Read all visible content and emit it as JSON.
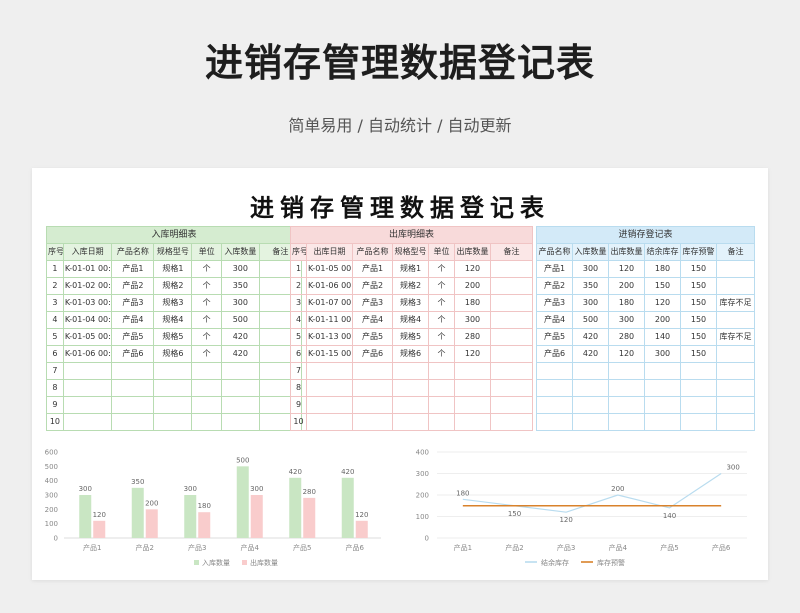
{
  "header": {
    "title": "进销存管理数据登记表",
    "subtitle": "简单易用 / 自动统计 / 自动更新"
  },
  "sheet": {
    "title": "进销存管理数据登记表"
  },
  "in_table": {
    "caption": "入库明细表",
    "headers": [
      "序号",
      "入库日期",
      "产品名称",
      "规格型号",
      "单位",
      "入库数量",
      "备注"
    ],
    "rows": [
      [
        "1",
        "K-01-01 00:0",
        "产品1",
        "规格1",
        "个",
        "300",
        ""
      ],
      [
        "2",
        "K-01-02 00:0",
        "产品2",
        "规格2",
        "个",
        "350",
        ""
      ],
      [
        "3",
        "K-01-03 00:0",
        "产品3",
        "规格3",
        "个",
        "300",
        ""
      ],
      [
        "4",
        "K-01-04 00:0",
        "产品4",
        "规格4",
        "个",
        "500",
        ""
      ],
      [
        "5",
        "K-01-05 00:0",
        "产品5",
        "规格5",
        "个",
        "420",
        ""
      ],
      [
        "6",
        "K-01-06 00:0",
        "产品6",
        "规格6",
        "个",
        "420",
        ""
      ],
      [
        "7",
        "",
        "",
        "",
        "",
        "",
        ""
      ],
      [
        "8",
        "",
        "",
        "",
        "",
        "",
        ""
      ],
      [
        "9",
        "",
        "",
        "",
        "",
        "",
        ""
      ],
      [
        "10",
        "",
        "",
        "",
        "",
        "",
        ""
      ]
    ]
  },
  "out_table": {
    "caption": "出库明细表",
    "headers": [
      "序号",
      "出库日期",
      "产品名称",
      "规格型号",
      "单位",
      "出库数量",
      "备注"
    ],
    "rows": [
      [
        "1",
        "K-01-05 00:0",
        "产品1",
        "规格1",
        "个",
        "120",
        ""
      ],
      [
        "2",
        "K-01-06 00:0",
        "产品2",
        "规格2",
        "个",
        "200",
        ""
      ],
      [
        "3",
        "K-01-07 00:0",
        "产品3",
        "规格3",
        "个",
        "180",
        ""
      ],
      [
        "4",
        "K-01-11 00:0",
        "产品4",
        "规格4",
        "个",
        "300",
        ""
      ],
      [
        "5",
        "K-01-13 00:0",
        "产品5",
        "规格5",
        "个",
        "280",
        ""
      ],
      [
        "6",
        "K-01-15 00:0",
        "产品6",
        "规格6",
        "个",
        "120",
        ""
      ],
      [
        "7",
        "",
        "",
        "",
        "",
        "",
        ""
      ],
      [
        "8",
        "",
        "",
        "",
        "",
        "",
        ""
      ],
      [
        "9",
        "",
        "",
        "",
        "",
        "",
        ""
      ],
      [
        "10",
        "",
        "",
        "",
        "",
        "",
        ""
      ]
    ]
  },
  "stock_table": {
    "caption": "进销存登记表",
    "headers": [
      "产品名称",
      "入库数量",
      "出库数量",
      "结余库存",
      "库存预警",
      "备注"
    ],
    "rows": [
      [
        "产品1",
        "300",
        "120",
        "180",
        "150",
        ""
      ],
      [
        "产品2",
        "350",
        "200",
        "150",
        "150",
        ""
      ],
      [
        "产品3",
        "300",
        "180",
        "120",
        "150",
        "库存不足"
      ],
      [
        "产品4",
        "500",
        "300",
        "200",
        "150",
        ""
      ],
      [
        "产品5",
        "420",
        "280",
        "140",
        "150",
        "库存不足"
      ],
      [
        "产品6",
        "420",
        "120",
        "300",
        "150",
        ""
      ],
      [
        "",
        "",
        "",
        "",
        "",
        ""
      ],
      [
        "",
        "",
        "",
        "",
        "",
        ""
      ],
      [
        "",
        "",
        "",
        "",
        "",
        ""
      ],
      [
        "",
        "",
        "",
        "",
        "",
        ""
      ]
    ]
  },
  "chart_data": [
    {
      "type": "bar",
      "categories": [
        "产品1",
        "产品2",
        "产品3",
        "产品4",
        "产品5",
        "产品6"
      ],
      "series": [
        {
          "name": "入库数量",
          "values": [
            300,
            350,
            300,
            500,
            420,
            420
          ],
          "color": "#c9e6c3"
        },
        {
          "name": "出库数量",
          "values": [
            120,
            200,
            180,
            300,
            280,
            120
          ],
          "color": "#f9cccc"
        }
      ],
      "ylim": [
        0,
        600
      ],
      "yticks": [
        0,
        100,
        200,
        300,
        400,
        500,
        600
      ],
      "legend": "bottom",
      "grid": false
    },
    {
      "type": "line",
      "categories": [
        "产品1",
        "产品2",
        "产品3",
        "产品4",
        "产品5",
        "产品6"
      ],
      "series": [
        {
          "name": "结余库存",
          "values": [
            180,
            150,
            120,
            200,
            140,
            300
          ],
          "color": "#b9dcef"
        },
        {
          "name": "库存预警",
          "values": [
            150,
            150,
            150,
            150,
            150,
            150
          ],
          "color": "#d9822b"
        }
      ],
      "ylim": [
        0,
        400
      ],
      "yticks": [
        0,
        100,
        200,
        300,
        400
      ],
      "labeled_series": 0,
      "legend": "bottom",
      "grid": true
    }
  ]
}
